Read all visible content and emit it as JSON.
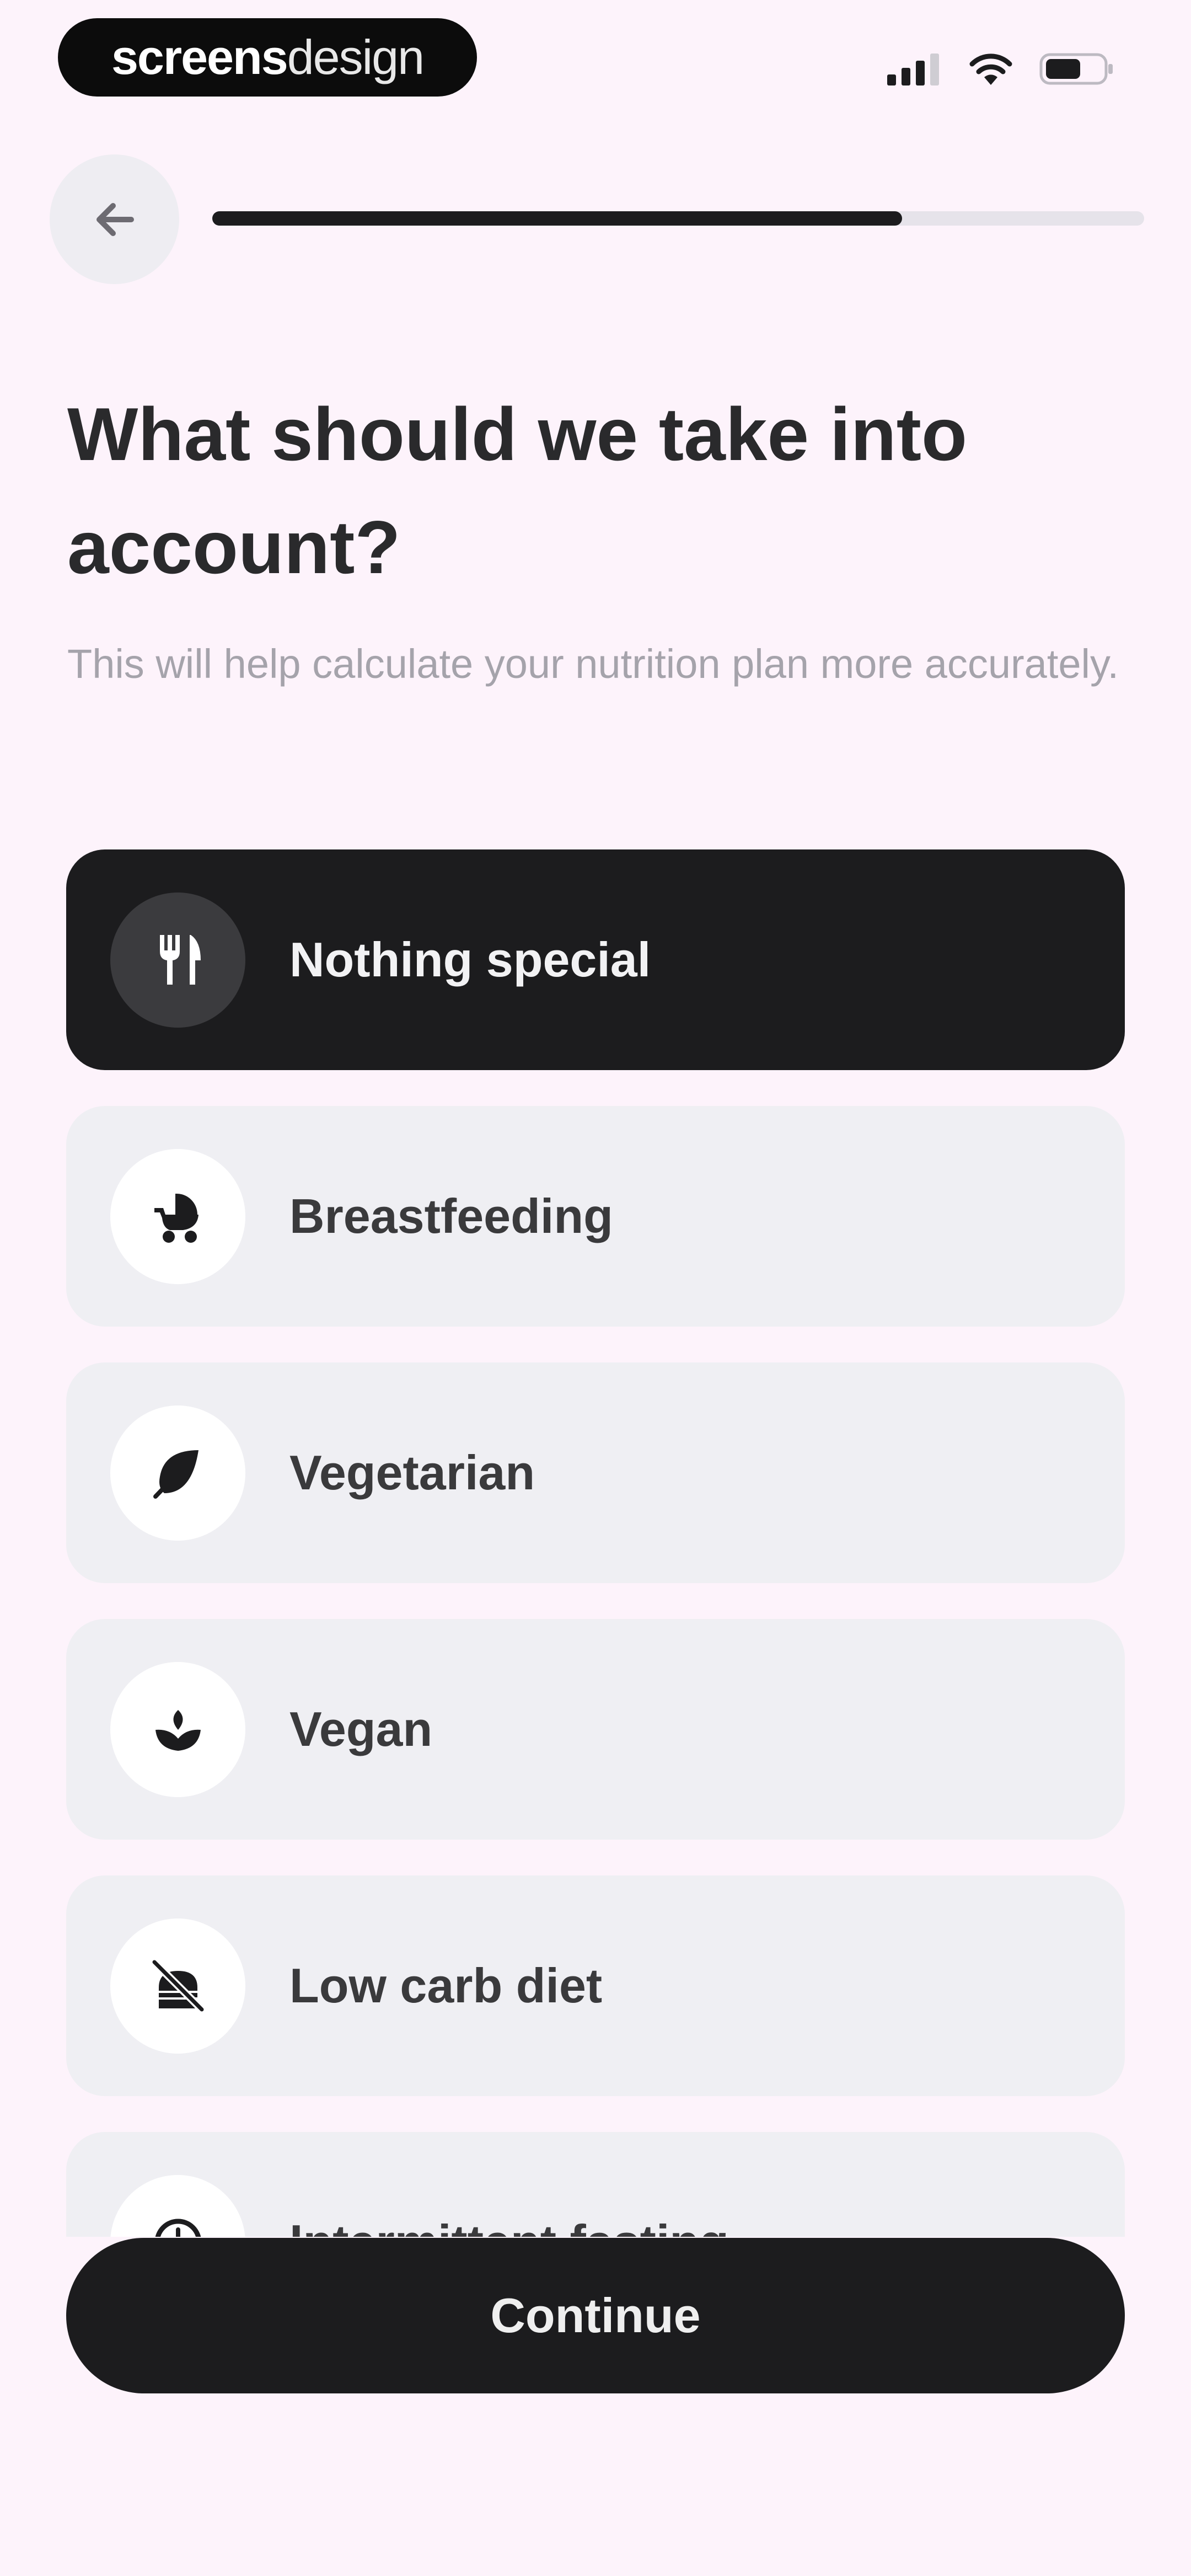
{
  "status_bar": {
    "brand_bold": "screens",
    "brand_light": "design",
    "icons": [
      "cellular-signal-icon",
      "wifi-icon",
      "battery-icon"
    ]
  },
  "header": {
    "back_icon": "arrow-left-icon",
    "progress_fraction": 0.74
  },
  "main": {
    "title": "What should we take into account?",
    "subtitle": "This will help calculate your nutrition plan more accurately."
  },
  "options": [
    {
      "label": "Nothing special",
      "icon": "fork-knife-icon",
      "selected": true
    },
    {
      "label": "Breastfeeding",
      "icon": "stroller-icon",
      "selected": false
    },
    {
      "label": "Vegetarian",
      "icon": "leaf-icon",
      "selected": false
    },
    {
      "label": "Vegan",
      "icon": "sprout-icon",
      "selected": false
    },
    {
      "label": "Low carb diet",
      "icon": "no-bread-icon",
      "selected": false
    },
    {
      "label": "Intermittent fasting",
      "icon": "clock-icon",
      "selected": false
    }
  ],
  "footer": {
    "continue_label": "Continue"
  },
  "colors": {
    "background": "#fdf3fb",
    "selected": "#1c1c1e",
    "option_bg": "#efeff3"
  }
}
